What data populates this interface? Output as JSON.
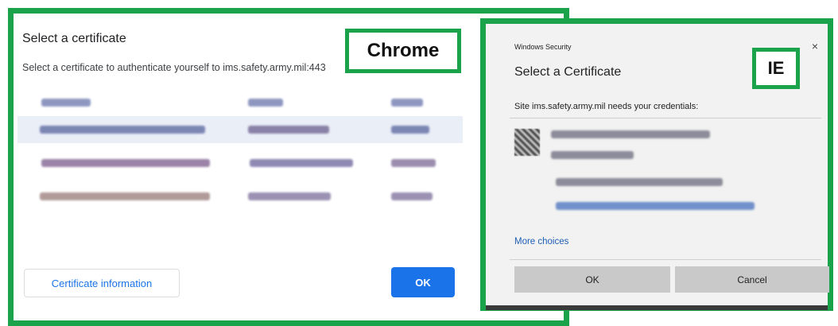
{
  "chrome": {
    "label": "Chrome",
    "title": "Select a certificate",
    "subtitle": "Select a certificate to authenticate yourself to ims.safety.army.mil:443",
    "info_button": "Certificate information",
    "ok_button": "OK"
  },
  "ie": {
    "label": "IE",
    "window_title": "Windows Security",
    "close": "×",
    "title": "Select a Certificate",
    "site_text": "Site ims.safety.army.mil needs your credentials:",
    "more_choices": "More choices",
    "ok_button": "OK",
    "cancel_button": "Cancel"
  },
  "colors": {
    "highlight_border": "#1aa34a",
    "chrome_blue": "#1a73e8",
    "ie_link": "#1e5fb6"
  }
}
